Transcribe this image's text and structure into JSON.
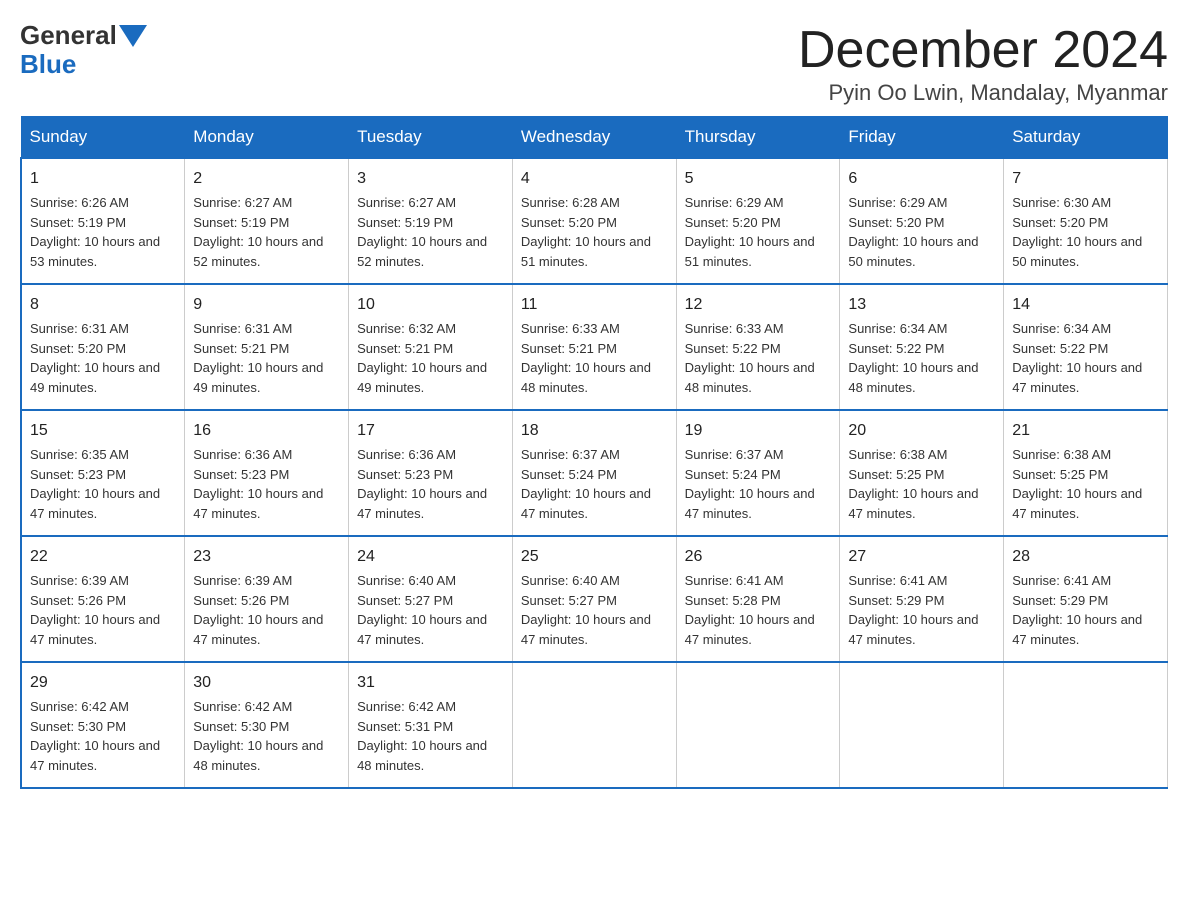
{
  "header": {
    "logo_general": "General",
    "logo_blue": "Blue",
    "month_title": "December 2024",
    "location": "Pyin Oo Lwin, Mandalay, Myanmar"
  },
  "days_of_week": [
    "Sunday",
    "Monday",
    "Tuesday",
    "Wednesday",
    "Thursday",
    "Friday",
    "Saturday"
  ],
  "weeks": [
    [
      {
        "day": "1",
        "sunrise": "Sunrise: 6:26 AM",
        "sunset": "Sunset: 5:19 PM",
        "daylight": "Daylight: 10 hours and 53 minutes."
      },
      {
        "day": "2",
        "sunrise": "Sunrise: 6:27 AM",
        "sunset": "Sunset: 5:19 PM",
        "daylight": "Daylight: 10 hours and 52 minutes."
      },
      {
        "day": "3",
        "sunrise": "Sunrise: 6:27 AM",
        "sunset": "Sunset: 5:19 PM",
        "daylight": "Daylight: 10 hours and 52 minutes."
      },
      {
        "day": "4",
        "sunrise": "Sunrise: 6:28 AM",
        "sunset": "Sunset: 5:20 PM",
        "daylight": "Daylight: 10 hours and 51 minutes."
      },
      {
        "day": "5",
        "sunrise": "Sunrise: 6:29 AM",
        "sunset": "Sunset: 5:20 PM",
        "daylight": "Daylight: 10 hours and 51 minutes."
      },
      {
        "day": "6",
        "sunrise": "Sunrise: 6:29 AM",
        "sunset": "Sunset: 5:20 PM",
        "daylight": "Daylight: 10 hours and 50 minutes."
      },
      {
        "day": "7",
        "sunrise": "Sunrise: 6:30 AM",
        "sunset": "Sunset: 5:20 PM",
        "daylight": "Daylight: 10 hours and 50 minutes."
      }
    ],
    [
      {
        "day": "8",
        "sunrise": "Sunrise: 6:31 AM",
        "sunset": "Sunset: 5:20 PM",
        "daylight": "Daylight: 10 hours and 49 minutes."
      },
      {
        "day": "9",
        "sunrise": "Sunrise: 6:31 AM",
        "sunset": "Sunset: 5:21 PM",
        "daylight": "Daylight: 10 hours and 49 minutes."
      },
      {
        "day": "10",
        "sunrise": "Sunrise: 6:32 AM",
        "sunset": "Sunset: 5:21 PM",
        "daylight": "Daylight: 10 hours and 49 minutes."
      },
      {
        "day": "11",
        "sunrise": "Sunrise: 6:33 AM",
        "sunset": "Sunset: 5:21 PM",
        "daylight": "Daylight: 10 hours and 48 minutes."
      },
      {
        "day": "12",
        "sunrise": "Sunrise: 6:33 AM",
        "sunset": "Sunset: 5:22 PM",
        "daylight": "Daylight: 10 hours and 48 minutes."
      },
      {
        "day": "13",
        "sunrise": "Sunrise: 6:34 AM",
        "sunset": "Sunset: 5:22 PM",
        "daylight": "Daylight: 10 hours and 48 minutes."
      },
      {
        "day": "14",
        "sunrise": "Sunrise: 6:34 AM",
        "sunset": "Sunset: 5:22 PM",
        "daylight": "Daylight: 10 hours and 47 minutes."
      }
    ],
    [
      {
        "day": "15",
        "sunrise": "Sunrise: 6:35 AM",
        "sunset": "Sunset: 5:23 PM",
        "daylight": "Daylight: 10 hours and 47 minutes."
      },
      {
        "day": "16",
        "sunrise": "Sunrise: 6:36 AM",
        "sunset": "Sunset: 5:23 PM",
        "daylight": "Daylight: 10 hours and 47 minutes."
      },
      {
        "day": "17",
        "sunrise": "Sunrise: 6:36 AM",
        "sunset": "Sunset: 5:23 PM",
        "daylight": "Daylight: 10 hours and 47 minutes."
      },
      {
        "day": "18",
        "sunrise": "Sunrise: 6:37 AM",
        "sunset": "Sunset: 5:24 PM",
        "daylight": "Daylight: 10 hours and 47 minutes."
      },
      {
        "day": "19",
        "sunrise": "Sunrise: 6:37 AM",
        "sunset": "Sunset: 5:24 PM",
        "daylight": "Daylight: 10 hours and 47 minutes."
      },
      {
        "day": "20",
        "sunrise": "Sunrise: 6:38 AM",
        "sunset": "Sunset: 5:25 PM",
        "daylight": "Daylight: 10 hours and 47 minutes."
      },
      {
        "day": "21",
        "sunrise": "Sunrise: 6:38 AM",
        "sunset": "Sunset: 5:25 PM",
        "daylight": "Daylight: 10 hours and 47 minutes."
      }
    ],
    [
      {
        "day": "22",
        "sunrise": "Sunrise: 6:39 AM",
        "sunset": "Sunset: 5:26 PM",
        "daylight": "Daylight: 10 hours and 47 minutes."
      },
      {
        "day": "23",
        "sunrise": "Sunrise: 6:39 AM",
        "sunset": "Sunset: 5:26 PM",
        "daylight": "Daylight: 10 hours and 47 minutes."
      },
      {
        "day": "24",
        "sunrise": "Sunrise: 6:40 AM",
        "sunset": "Sunset: 5:27 PM",
        "daylight": "Daylight: 10 hours and 47 minutes."
      },
      {
        "day": "25",
        "sunrise": "Sunrise: 6:40 AM",
        "sunset": "Sunset: 5:27 PM",
        "daylight": "Daylight: 10 hours and 47 minutes."
      },
      {
        "day": "26",
        "sunrise": "Sunrise: 6:41 AM",
        "sunset": "Sunset: 5:28 PM",
        "daylight": "Daylight: 10 hours and 47 minutes."
      },
      {
        "day": "27",
        "sunrise": "Sunrise: 6:41 AM",
        "sunset": "Sunset: 5:29 PM",
        "daylight": "Daylight: 10 hours and 47 minutes."
      },
      {
        "day": "28",
        "sunrise": "Sunrise: 6:41 AM",
        "sunset": "Sunset: 5:29 PM",
        "daylight": "Daylight: 10 hours and 47 minutes."
      }
    ],
    [
      {
        "day": "29",
        "sunrise": "Sunrise: 6:42 AM",
        "sunset": "Sunset: 5:30 PM",
        "daylight": "Daylight: 10 hours and 47 minutes."
      },
      {
        "day": "30",
        "sunrise": "Sunrise: 6:42 AM",
        "sunset": "Sunset: 5:30 PM",
        "daylight": "Daylight: 10 hours and 48 minutes."
      },
      {
        "day": "31",
        "sunrise": "Sunrise: 6:42 AM",
        "sunset": "Sunset: 5:31 PM",
        "daylight": "Daylight: 10 hours and 48 minutes."
      },
      {
        "day": "",
        "sunrise": "",
        "sunset": "",
        "daylight": ""
      },
      {
        "day": "",
        "sunrise": "",
        "sunset": "",
        "daylight": ""
      },
      {
        "day": "",
        "sunrise": "",
        "sunset": "",
        "daylight": ""
      },
      {
        "day": "",
        "sunrise": "",
        "sunset": "",
        "daylight": ""
      }
    ]
  ]
}
